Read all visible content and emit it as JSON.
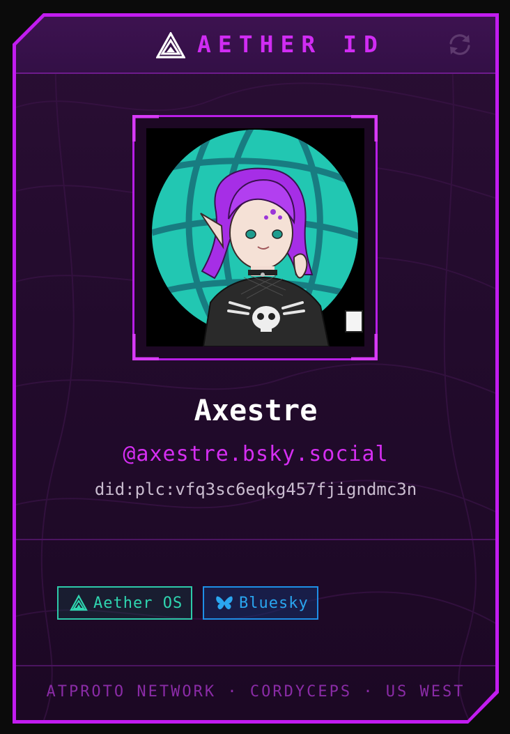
{
  "header": {
    "title": "AETHER ID",
    "logo_icon": "aether-triangle-logo",
    "refresh_icon": "refresh-icon"
  },
  "profile": {
    "avatar": "avatar-illustration",
    "display_name": "Axestre",
    "handle": "@axestre.bsky.social",
    "did": "did:plc:vfq3sc6eqkg457fjigndmc3n"
  },
  "tags": [
    {
      "label": "Aether OS",
      "icon": "aether-triangle-icon",
      "color": "#2fd6b0"
    },
    {
      "label": "Bluesky",
      "icon": "butterfly-icon",
      "color": "#2aa6f0"
    }
  ],
  "footer": {
    "text": "ATPROTO NETWORK · CORDYCEPS · US WEST"
  },
  "colors": {
    "accent": "#c21cf0",
    "background": "#220b2c",
    "teal": "#2fd6b0",
    "blue": "#2aa6f0"
  }
}
